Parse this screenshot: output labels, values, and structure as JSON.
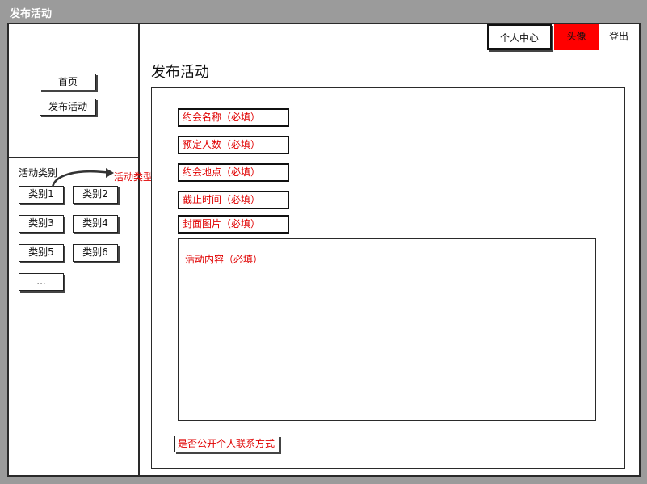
{
  "window": {
    "title": "发布活动"
  },
  "sidebar": {
    "nav": [
      {
        "label": "首页"
      },
      {
        "label": "发布活动"
      }
    ],
    "category_title": "活动类别",
    "categories": [
      "类别1",
      "类别2",
      "类别3",
      "类别4",
      "类别5",
      "类别6",
      "..."
    ],
    "annotation": "活动类型"
  },
  "header": {
    "personal_center": "个人中心",
    "avatar": "头像",
    "logout": "登出"
  },
  "main": {
    "page_title": "发布活动",
    "fields": [
      {
        "label": "约会名称（必填）"
      },
      {
        "label": "预定人数（必填）"
      },
      {
        "label": "约会地点（必填）"
      },
      {
        "label": "截止时间（必填）"
      },
      {
        "label": "封面图片（必填）"
      }
    ],
    "content_placeholder": "活动内容（必填）",
    "public_contact": "是否公开个人联系方式"
  },
  "colors": {
    "avatar_bg": "#ff0000",
    "required_text": "#e00000",
    "chrome": "#9b9b9b"
  }
}
